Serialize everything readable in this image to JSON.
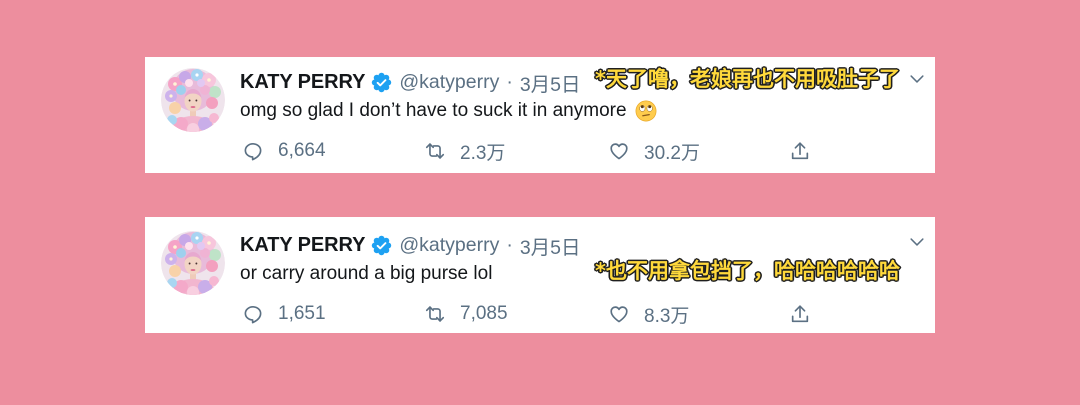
{
  "page": {
    "background": "#ED8E9E"
  },
  "theme": {
    "text": "#14171A",
    "muted": "#5B7083",
    "verified": "#1DA1F2",
    "annotation_fill": "#FFD93B",
    "annotation_stroke": "#1F1F1F"
  },
  "tweets": [
    {
      "author": {
        "name": "KATY PERRY",
        "verified_icon": "verified-badge-icon",
        "handle": "@katyperry",
        "separator": "·",
        "date": "3月5日"
      },
      "menu_icon": "chevron-down-icon",
      "text": "omg so glad I don’t have to suck it in anymore",
      "emoji_icon": "face-with-rolling-eyes-icon",
      "actions": [
        {
          "icon": "reply-icon",
          "count": "6,664"
        },
        {
          "icon": "retweet-icon",
          "count": "2.3万"
        },
        {
          "icon": "like-icon",
          "count": "30.2万"
        },
        {
          "icon": "share-icon"
        }
      ],
      "annotation": "*天了噜，老娘再也不用吸肚子了"
    },
    {
      "author": {
        "name": "KATY PERRY",
        "verified_icon": "verified-badge-icon",
        "handle": "@katyperry",
        "separator": "·",
        "date": "3月5日"
      },
      "menu_icon": "chevron-down-icon",
      "text": "or carry around a big purse lol",
      "actions": [
        {
          "icon": "reply-icon",
          "count": "1,651"
        },
        {
          "icon": "retweet-icon",
          "count": "7,085"
        },
        {
          "icon": "like-icon",
          "count": "8.3万"
        },
        {
          "icon": "share-icon"
        }
      ],
      "annotation": "*也不用拿包挡了，哈哈哈哈哈哈"
    }
  ]
}
